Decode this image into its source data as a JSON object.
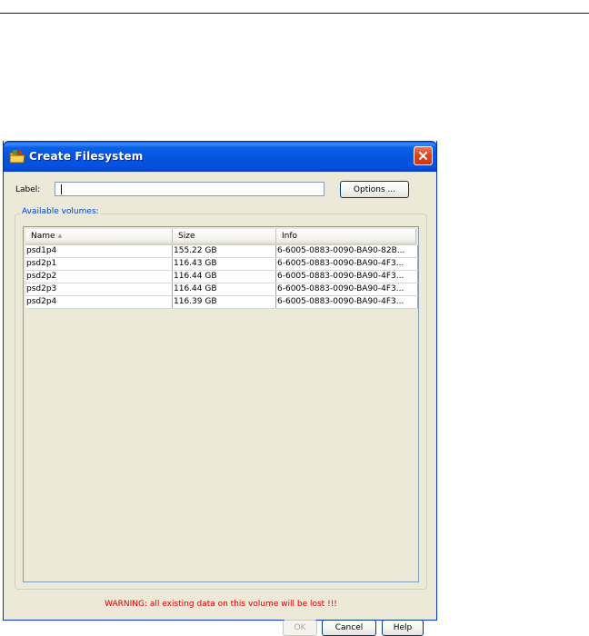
{
  "window": {
    "title": "Create Filesystem",
    "title_icon": "folder-icon"
  },
  "form": {
    "label_caption": "Label:",
    "label_value": "",
    "options_button": "Options ..."
  },
  "volumes": {
    "group_title": "Available volumes:",
    "columns": [
      "Name",
      "Size",
      "Info"
    ],
    "rows": [
      {
        "name": "psd1p4",
        "size": "155.22 GB",
        "info": "6-6005-0883-0090-BA90-82B..."
      },
      {
        "name": "psd2p1",
        "size": "116.43 GB",
        "info": "6-6005-0883-0090-BA90-4F3..."
      },
      {
        "name": "psd2p2",
        "size": "116.44 GB",
        "info": "6-6005-0883-0090-BA90-4F3..."
      },
      {
        "name": "psd2p3",
        "size": "116.44 GB",
        "info": "6-6005-0883-0090-BA90-4F3..."
      },
      {
        "name": "psd2p4",
        "size": "116.39 GB",
        "info": "6-6005-0883-0090-BA90-4F3..."
      }
    ]
  },
  "warning": "WARNING: all existing data on this volume will be lost !!!",
  "buttons": {
    "ok": "OK",
    "cancel": "Cancel",
    "help": "Help"
  },
  "colors": {
    "titlebar": "#0453dd",
    "warning": "#e00000",
    "group_title": "#0046d5",
    "dialog_bg": "#ece9d8"
  }
}
